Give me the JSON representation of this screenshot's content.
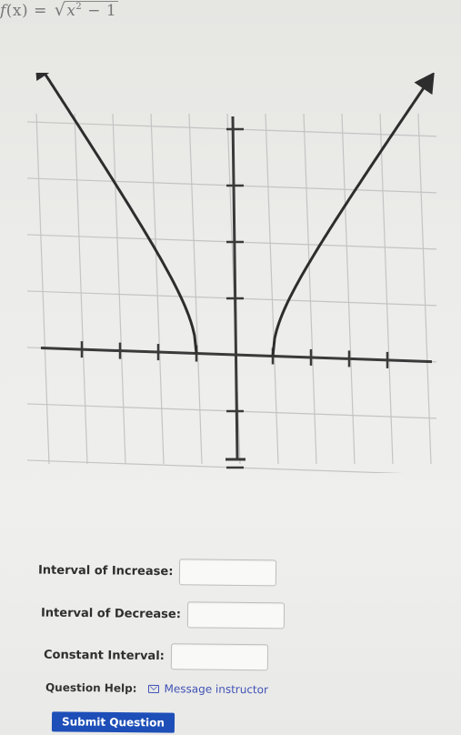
{
  "question": {
    "func_name": "f",
    "func_var": "(x)",
    "equals": "=",
    "sqrt_symbol": "√",
    "radicand_base": "x",
    "radicand_exp": "2",
    "radicand_rest": " − 1"
  },
  "graph": {
    "type": "function-graph",
    "function": "sqrt(x^2 - 1)",
    "domain": [
      "(-inf, -1]",
      "[1, inf)"
    ],
    "grid": true,
    "arrows": true
  },
  "form": {
    "increase_label": "Interval of Increase:",
    "decrease_label": "Interval of Decrease:",
    "constant_label": "Constant Interval:",
    "increase_value": "",
    "decrease_value": "",
    "constant_value": ""
  },
  "help": {
    "label": "Question Help:",
    "message_link": "Message instructor",
    "icon": "mail-icon"
  },
  "submit_label": "Submit Question",
  "colors": {
    "accent": "#1e4fb8",
    "link": "#3f51b5"
  }
}
